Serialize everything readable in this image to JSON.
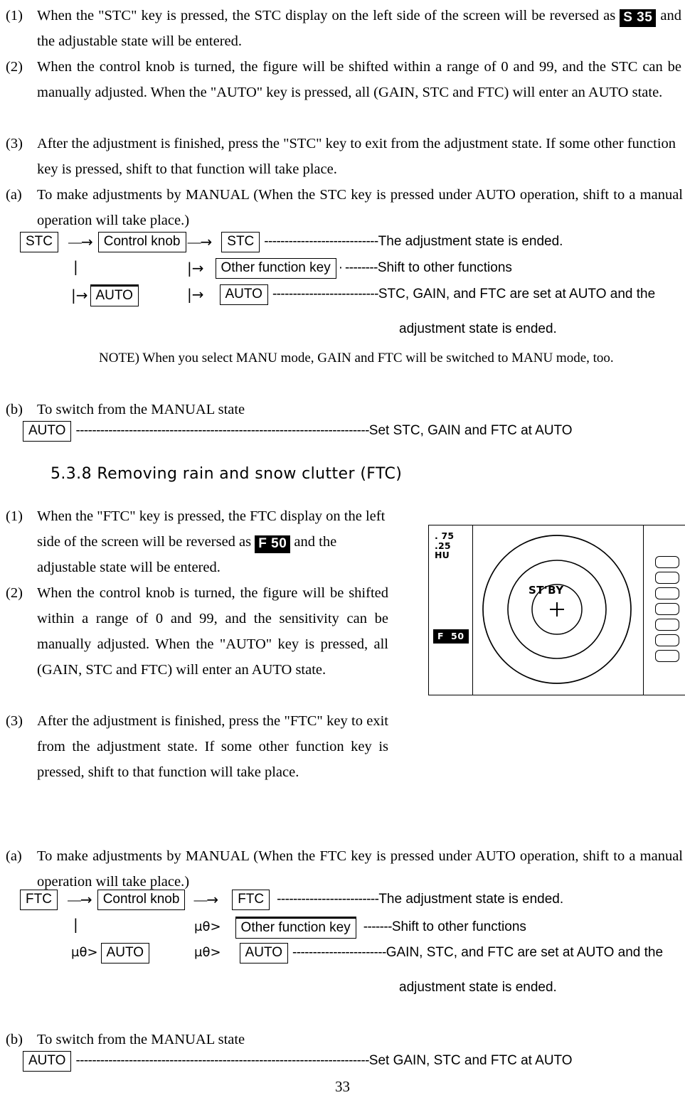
{
  "page": {
    "number": "33"
  },
  "stc_section": {
    "items": [
      {
        "num": "(1)",
        "text_before": "When the \"STC\" key is pressed, the STC display on the left side of the screen will be reversed as ",
        "badge": "S 35",
        "text_after": " and the adjustable state will be entered."
      },
      {
        "num": "(2)",
        "text": "When the control knob is turned, the figure will be shifted within a range of 0 and 99, and the STC can be manually adjusted.  When the \"AUTO\" key is pressed, all (GAIN, STC and FTC) will enter an AUTO state."
      },
      {
        "num": "(3)",
        "text": "After the adjustment is finished, press the \"STC\" key to exit from the adjustment state.  If some other function key is pressed, shift to that function will take place."
      },
      {
        "num": "(a)",
        "text": "To make adjustments by MANUAL (When the STC key is pressed under AUTO operation, shift to a manual operation will take place.)"
      }
    ],
    "diagram": {
      "row1": {
        "key_start": "STC",
        "arrow1": "⎯⎯→",
        "key_mid": "Control knob",
        "arrow2": "⎯⎯→",
        "key_end": "STC",
        "leader": "----------------------------",
        "desc": "The adjustment state is ended."
      },
      "row2": {
        "stem_left": "|",
        "branch": "|→",
        "key_end": "Other function key",
        "dot": "·",
        "leader": "--------",
        "desc": "Shift to other functions"
      },
      "row3": {
        "branch_left": "|→",
        "key_left": "AUTO",
        "branch": "|→",
        "key_end": "AUTO",
        "leader": "--------------------------",
        "desc": "STC, GAIN, and FTC are set at AUTO and the"
      },
      "continuation": "adjustment state is ended."
    },
    "note": "NOTE) When you select MANU mode, GAIN and FTC will be switched to MANU mode, too.",
    "switch_item": {
      "num": "(b)",
      "title": "To switch from the MANUAL state",
      "key": "AUTO",
      "leader": "------------------------------------------------------------------------",
      "desc": "Set STC, GAIN and FTC at AUTO"
    }
  },
  "ftc_section": {
    "heading": "5.3.8 Removing rain and snow clutter (FTC)",
    "items": [
      {
        "num": "(1)",
        "text_before": "When the \"FTC\" key is pressed, the FTC display on the left side of the screen will be reversed as ",
        "badge": "F 50",
        "text_after": "    and the adjustable state will be entered."
      },
      {
        "num": "(2)",
        "text": "When the control knob is turned, the figure will be shifted within a range of  0 and 99, and the sensitivity can be manually adjusted.   When the \"AUTO\" key is pressed, all (GAIN, STC and FTC) will enter an AUTO state."
      },
      {
        "num": "(3)",
        "text": " After the adjustment is finished, press the \"FTC\" key to exit from the adjustment state.   If some other function key is pressed, shift to that function will take place."
      },
      {
        "num": "(a)",
        "text": "To make adjustments by MANUAL (When the FTC key is pressed under AUTO operation, shift to a manual operation will take place.)"
      }
    ],
    "diagram": {
      "row1": {
        "key_start": "FTC",
        "arrow1": "⎯⎯→",
        "key_mid": "Control knob",
        "arrow2": "⎯⎯→",
        "key_end": "FTC",
        "leader": "-------------------------",
        "desc": "The adjustment state is ended."
      },
      "row2": {
        "stem_left": "|",
        "branch": "μθ>",
        "key_end": "Other function key",
        "leader": "-------",
        "desc": "Shift to other functions"
      },
      "row3": {
        "branch_left": "μθ>",
        "key_left": "AUTO",
        "branch": "μθ>",
        "key_end": "AUTO",
        "leader": "-----------------------",
        "desc": "GAIN, STC, and FTC are set at AUTO and the"
      },
      "continuation": "adjustment state is ended."
    },
    "switch_item": {
      "num": "(b)",
      "title": "To switch from the MANUAL state",
      "key": "AUTO",
      "leader": "------------------------------------------------------------------------",
      "desc": "Set GAIN, STC and FTC at AUTO"
    }
  },
  "radar_display": {
    "range_line1": ". 75",
    "range_line2": ".25",
    "mode": "HU",
    "ftc_badge": "F  50",
    "status": "ST'BY",
    "crosshair": "+",
    "softkey_count": 7
  }
}
